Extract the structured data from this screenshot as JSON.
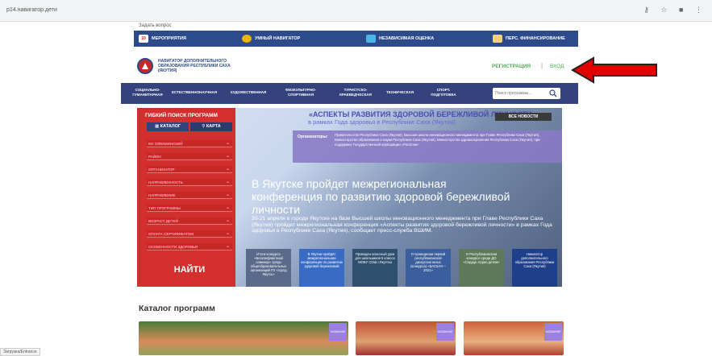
{
  "browser": {
    "url": "p14.навигатор.дети",
    "icons": "⚷ ☆ ■ ⋮"
  },
  "top": {
    "ask_question": "Задать вопрос",
    "nav": [
      {
        "label": "МЕРОПРИЯТИЯ",
        "icon": "calendar-icon",
        "badge": "10"
      },
      {
        "label": "УМНЫЙ НАВИГАТОР",
        "icon": "people-icon"
      },
      {
        "label": "НЕЗАВИСИМАЯ ОЦЕНКА",
        "icon": "chart-icon"
      },
      {
        "label": "ПЕРС. ФИНАНСИРОВАНИЕ",
        "icon": "card-icon"
      }
    ]
  },
  "header": {
    "logo_text": "НАВИГАТОР ДОПОЛНИТЕЛЬНОГО ОБРАЗОВАНИЯ РЕСПУБЛИКИ САХА (ЯКУТИЯ)",
    "register": "РЕГИСТРАЦИЯ",
    "separator": "|",
    "login": "ВХОД"
  },
  "categories": [
    "СОЦИАЛЬНО-\nГУМАНИТАРНАЯ",
    "ЕСТЕСТВЕННОНАУЧНАЯ",
    "ХУДОЖЕСТВЕННАЯ",
    "ФИЗКУЛЬТУРНО-\nСПОРТИВНАЯ",
    "ТУРИСТСКО-\nКРАЕВЕДЧЕСКАЯ",
    "ТЕХНИЧЕСКАЯ",
    "СПОРТ.\nПОДГОТОВКА"
  ],
  "search": {
    "placeholder": "Поиск программы..."
  },
  "panel": {
    "title": "ГИБКИЙ ПОИСК ПРОГРАММ",
    "tab_catalog": "КАТАЛОГ",
    "tab_map": "КАРТА",
    "filters": [
      "МУ ОЛЕКМИНСКИЙ",
      "РАЙОН",
      "ОРГАНИЗАТОР",
      "НАПРАВЛЕННОСТЬ",
      "НАПРАВЛЕНИЕ",
      "ТИП ПРОГРАММЫ",
      "ВОЗРАСТ ДЕТЕЙ",
      "ОПЛАТА СЕРТИФИКАТОМ",
      "ОСОБЕННОСТИ ЗДОРОВЬЯ"
    ],
    "find": "НАЙТИ"
  },
  "hero": {
    "title": "«АСПЕКТЫ РАЗВИТИЯ ЗДОРОВОЙ БЕРЕЖЛИВОЙ ЛИЧНОСТИ»",
    "subtitle": "в рамках Года здоровья в Республике Саха (Якутия)",
    "all_news": "ВСЕ НОВОСТИ",
    "org_label": "Организаторы:",
    "org_text": "Правительство Республики Саха (Якутия), Высшая школа инновационного менеджмента при Главе Республики Саха (Якутия), Министерство образования и науки Республики Саха (Якутия), Министерство здравоохранения Республики Саха (Якутия), при поддержке Государственной корпорации «Росатом»",
    "headline": "В Якутске пройдет межрегиональная конференция по развитию здоровой бережливой личности",
    "description": "20-21 апреля в городе Якутске на базе Высшей школы инновационного менеджмента при Главе Республики Саха (Якутия) пройдет межрегиональная конференция «Аспекты развития здоровой бережливой личности» в рамках Года здоровья в Республике Саха (Якутия), сообщает пресс-служба ВШИМ.",
    "thumbs": [
      {
        "text": "Итоги конкурса «Бесконфликтный семинар» среди общеобразовательных организаций ГО «город Якутск»",
        "color": "#5a6a8a"
      },
      {
        "text": "В Якутии пройдёт межрегиональная конференция по развитию здоровой бережливой",
        "color": "#3a6bc4"
      },
      {
        "text": "Проведен классный урок для школьников 5 класса МОБУ СОШ г.Якутска",
        "color": "#2f4f6f"
      },
      {
        "text": "О проведении первой республиканской дискуссии юных (конкурса) «БАСХАН – 2021»",
        "color": "#3a5f9c"
      },
      {
        "text": "О Республиканском конкурсе среди ДО «Сердце отдаю детям»",
        "color": "#5c7a5a"
      },
      {
        "text": "Навигатор дополнительного образования Республики Саха (Якутия)",
        "color": "#1e3f8a"
      }
    ]
  },
  "catalog": {
    "title": "Каталог программ",
    "badge": "НАЗВАНИЕ"
  },
  "status": "Загрузка/Entrance",
  "colors": {
    "nav": "#2d4a8a",
    "panel": "#d32f2f",
    "accent_green": "#4caf50",
    "arrow": "#e00000"
  }
}
